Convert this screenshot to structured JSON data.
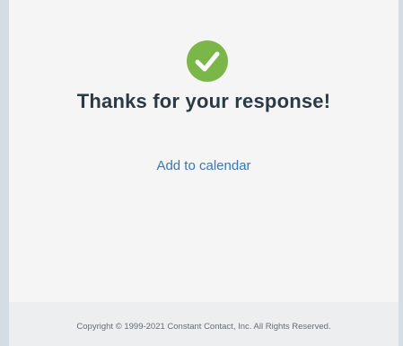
{
  "confirmation": {
    "icon": "checkmark-circle-icon",
    "icon_color": "#7ab648",
    "title": "Thanks for your response!",
    "calendar_link": "Add to calendar"
  },
  "footer": {
    "copyright": "Copyright © 1999-2021 Constant Contact, Inc. All Rights Reserved."
  },
  "colors": {
    "background": "#d3dde3",
    "card": "#f5f5f5",
    "link": "#3a77b5",
    "title": "#2b3a44"
  }
}
